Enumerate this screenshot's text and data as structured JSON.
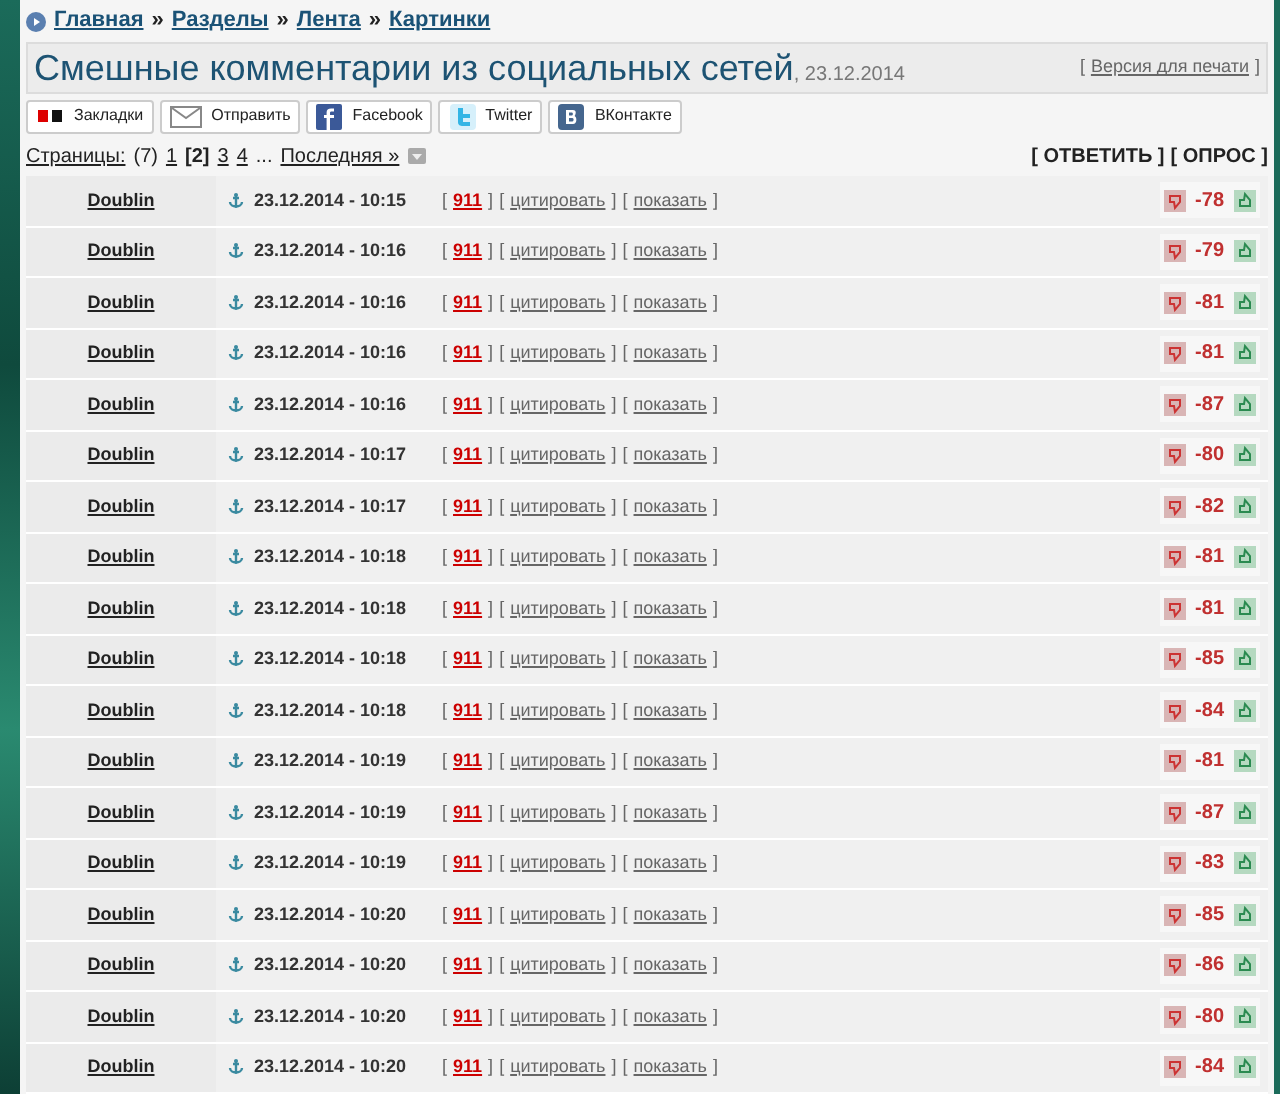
{
  "breadcrumb": [
    "Главная",
    "Разделы",
    "Лента",
    "Картинки"
  ],
  "breadcrumb_separator": "»",
  "title": "Смешные комментарии из социальных сетей",
  "title_date": ", 23.12.2014",
  "print_link": {
    "open": "[",
    "label": "Версия для печати",
    "close": "]"
  },
  "share_buttons": [
    {
      "kind": "bookmarks",
      "label": "Закладки"
    },
    {
      "kind": "mail",
      "label": "Отправить"
    },
    {
      "kind": "facebook",
      "label": "Facebook"
    },
    {
      "kind": "twitter",
      "label": "Twitter"
    },
    {
      "kind": "vk",
      "label": "ВКонтакте"
    }
  ],
  "pagination": {
    "label": "Страницы:",
    "count": "(7)",
    "pages": [
      {
        "label": "1",
        "selected": false
      },
      {
        "label": "[2]",
        "selected": true
      },
      {
        "label": "3",
        "selected": false
      },
      {
        "label": "4",
        "selected": false
      }
    ],
    "ellipsis": "...",
    "last": "Последняя »"
  },
  "actions": [
    "[ ОТВЕТИТЬ ]",
    "[ ОПРОС ]"
  ],
  "comments": [
    {
      "author": "Doublin",
      "time": "23.12.2014 - 10:15",
      "links": [
        {
          "kind": "id",
          "open": "[",
          "label": "911",
          "close": "]"
        },
        {
          "kind": "plain",
          "open": "[",
          "label": "цитировать",
          "close": "]"
        },
        {
          "kind": "plain",
          "open": "[",
          "label": "показать",
          "close": "]"
        }
      ],
      "score": "-78"
    },
    {
      "author": "Doublin",
      "time": "23.12.2014 - 10:16",
      "links": [
        {
          "kind": "id",
          "open": "[",
          "label": "911",
          "close": "]"
        },
        {
          "kind": "plain",
          "open": "[",
          "label": "цитировать",
          "close": "]"
        },
        {
          "kind": "plain",
          "open": "[",
          "label": "показать",
          "close": "]"
        }
      ],
      "score": "-79"
    },
    {
      "author": "Doublin",
      "time": "23.12.2014 - 10:16",
      "links": [
        {
          "kind": "id",
          "open": "[",
          "label": "911",
          "close": "]"
        },
        {
          "kind": "plain",
          "open": "[",
          "label": "цитировать",
          "close": "]"
        },
        {
          "kind": "plain",
          "open": "[",
          "label": "показать",
          "close": "]"
        }
      ],
      "score": "-81"
    },
    {
      "author": "Doublin",
      "time": "23.12.2014 - 10:16",
      "links": [
        {
          "kind": "id",
          "open": "[",
          "label": "911",
          "close": "]"
        },
        {
          "kind": "plain",
          "open": "[",
          "label": "цитировать",
          "close": "]"
        },
        {
          "kind": "plain",
          "open": "[",
          "label": "показать",
          "close": "]"
        }
      ],
      "score": "-81"
    },
    {
      "author": "Doublin",
      "time": "23.12.2014 - 10:16",
      "links": [
        {
          "kind": "id",
          "open": "[",
          "label": "911",
          "close": "]"
        },
        {
          "kind": "plain",
          "open": "[",
          "label": "цитировать",
          "close": "]"
        },
        {
          "kind": "plain",
          "open": "[",
          "label": "показать",
          "close": "]"
        }
      ],
      "score": "-87"
    },
    {
      "author": "Doublin",
      "time": "23.12.2014 - 10:17",
      "links": [
        {
          "kind": "id",
          "open": "[",
          "label": "911",
          "close": "]"
        },
        {
          "kind": "plain",
          "open": "[",
          "label": "цитировать",
          "close": "]"
        },
        {
          "kind": "plain",
          "open": "[",
          "label": "показать",
          "close": "]"
        }
      ],
      "score": "-80"
    },
    {
      "author": "Doublin",
      "time": "23.12.2014 - 10:17",
      "links": [
        {
          "kind": "id",
          "open": "[",
          "label": "911",
          "close": "]"
        },
        {
          "kind": "plain",
          "open": "[",
          "label": "цитировать",
          "close": "]"
        },
        {
          "kind": "plain",
          "open": "[",
          "label": "показать",
          "close": "]"
        }
      ],
      "score": "-82"
    },
    {
      "author": "Doublin",
      "time": "23.12.2014 - 10:18",
      "links": [
        {
          "kind": "id",
          "open": "[",
          "label": "911",
          "close": "]"
        },
        {
          "kind": "plain",
          "open": "[",
          "label": "цитировать",
          "close": "]"
        },
        {
          "kind": "plain",
          "open": "[",
          "label": "показать",
          "close": "]"
        }
      ],
      "score": "-81"
    },
    {
      "author": "Doublin",
      "time": "23.12.2014 - 10:18",
      "links": [
        {
          "kind": "id",
          "open": "[",
          "label": "911",
          "close": "]"
        },
        {
          "kind": "plain",
          "open": "[",
          "label": "цитировать",
          "close": "]"
        },
        {
          "kind": "plain",
          "open": "[",
          "label": "показать",
          "close": "]"
        }
      ],
      "score": "-81"
    },
    {
      "author": "Doublin",
      "time": "23.12.2014 - 10:18",
      "links": [
        {
          "kind": "id",
          "open": "[",
          "label": "911",
          "close": "]"
        },
        {
          "kind": "plain",
          "open": "[",
          "label": "цитировать",
          "close": "]"
        },
        {
          "kind": "plain",
          "open": "[",
          "label": "показать",
          "close": "]"
        }
      ],
      "score": "-85"
    },
    {
      "author": "Doublin",
      "time": "23.12.2014 - 10:18",
      "links": [
        {
          "kind": "id",
          "open": "[",
          "label": "911",
          "close": "]"
        },
        {
          "kind": "plain",
          "open": "[",
          "label": "цитировать",
          "close": "]"
        },
        {
          "kind": "plain",
          "open": "[",
          "label": "показать",
          "close": "]"
        }
      ],
      "score": "-84"
    },
    {
      "author": "Doublin",
      "time": "23.12.2014 - 10:19",
      "links": [
        {
          "kind": "id",
          "open": "[",
          "label": "911",
          "close": "]"
        },
        {
          "kind": "plain",
          "open": "[",
          "label": "цитировать",
          "close": "]"
        },
        {
          "kind": "plain",
          "open": "[",
          "label": "показать",
          "close": "]"
        }
      ],
      "score": "-81"
    },
    {
      "author": "Doublin",
      "time": "23.12.2014 - 10:19",
      "links": [
        {
          "kind": "id",
          "open": "[",
          "label": "911",
          "close": "]"
        },
        {
          "kind": "plain",
          "open": "[",
          "label": "цитировать",
          "close": "]"
        },
        {
          "kind": "plain",
          "open": "[",
          "label": "показать",
          "close": "]"
        }
      ],
      "score": "-87"
    },
    {
      "author": "Doublin",
      "time": "23.12.2014 - 10:19",
      "links": [
        {
          "kind": "id",
          "open": "[",
          "label": "911",
          "close": "]"
        },
        {
          "kind": "plain",
          "open": "[",
          "label": "цитировать",
          "close": "]"
        },
        {
          "kind": "plain",
          "open": "[",
          "label": "показать",
          "close": "]"
        }
      ],
      "score": "-83"
    },
    {
      "author": "Doublin",
      "time": "23.12.2014 - 10:20",
      "links": [
        {
          "kind": "id",
          "open": "[",
          "label": "911",
          "close": "]"
        },
        {
          "kind": "plain",
          "open": "[",
          "label": "цитировать",
          "close": "]"
        },
        {
          "kind": "plain",
          "open": "[",
          "label": "показать",
          "close": "]"
        }
      ],
      "score": "-85"
    },
    {
      "author": "Doublin",
      "time": "23.12.2014 - 10:20",
      "links": [
        {
          "kind": "id",
          "open": "[",
          "label": "911",
          "close": "]"
        },
        {
          "kind": "plain",
          "open": "[",
          "label": "цитировать",
          "close": "]"
        },
        {
          "kind": "plain",
          "open": "[",
          "label": "показать",
          "close": "]"
        }
      ],
      "score": "-86"
    },
    {
      "author": "Doublin",
      "time": "23.12.2014 - 10:20",
      "links": [
        {
          "kind": "id",
          "open": "[",
          "label": "911",
          "close": "]"
        },
        {
          "kind": "plain",
          "open": "[",
          "label": "цитировать",
          "close": "]"
        },
        {
          "kind": "plain",
          "open": "[",
          "label": "показать",
          "close": "]"
        }
      ],
      "score": "-80"
    },
    {
      "author": "Doublin",
      "time": "23.12.2014 - 10:20",
      "links": [
        {
          "kind": "id",
          "open": "[",
          "label": "911",
          "close": "]"
        },
        {
          "kind": "plain",
          "open": "[",
          "label": "цитировать",
          "close": "]"
        },
        {
          "kind": "plain",
          "open": "[",
          "label": "показать",
          "close": "]"
        }
      ],
      "score": "-84"
    }
  ]
}
